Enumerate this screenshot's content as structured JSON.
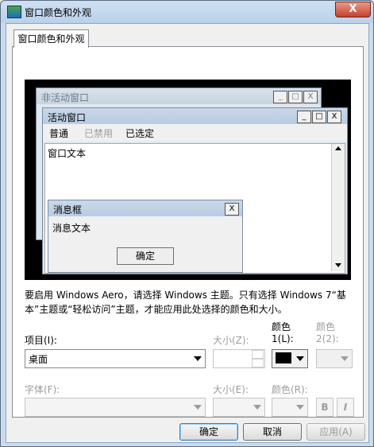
{
  "window": {
    "title": "窗口颜色和外观",
    "close_glyph": "X"
  },
  "tab": {
    "label": "窗口颜色和外观"
  },
  "preview": {
    "inactive_title": "非活动窗口",
    "active_title": "活动窗口",
    "menu": [
      "普通",
      "已禁用",
      "已选定"
    ],
    "window_text": "窗口文本",
    "msgbox_title": "消息框",
    "msgbox_text": "消息文本",
    "msgbox_ok": "确定",
    "caption_glyphs": {
      "min": "_",
      "max": "□",
      "close": "X"
    }
  },
  "description": "要启用 Windows Aero，请选择 Windows 主题。只有选择 Windows 7“基本”主题或“轻松访问”主题，才能应用此处选择的颜色和大小。",
  "form": {
    "item_label": "项目(I):",
    "item_value": "桌面",
    "size_label": "大小(Z):",
    "color1_label_a": "颜色",
    "color1_label_b": "1(L):",
    "color2_label_a": "颜色",
    "color2_label_b": "2(2):",
    "font_label": "字体(F):",
    "font_size_label": "大小(E):",
    "font_color_label": "颜色(R):",
    "bold_glyph": "B",
    "italic_glyph": "I",
    "color1_value": "#000000"
  },
  "buttons": {
    "ok": "确定",
    "cancel": "取消",
    "apply": "应用(A)"
  }
}
